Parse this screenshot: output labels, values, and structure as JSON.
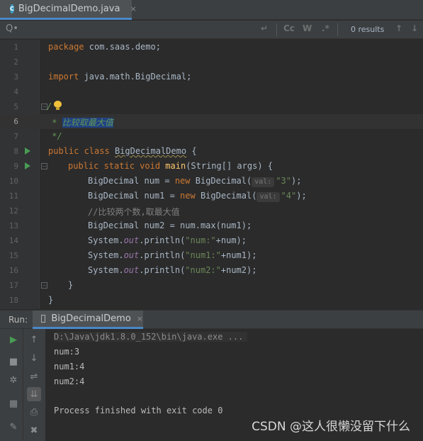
{
  "editor_tab": {
    "label": "BigDecimalDemo.java",
    "close": "×"
  },
  "search": {
    "icon": "Q•",
    "value": "",
    "results": "0 results",
    "btn_cc": "Cc",
    "btn_w": "W",
    "btn_regex": ".*"
  },
  "code_lines": [
    {
      "n": "1"
    },
    {
      "n": "2"
    },
    {
      "n": "3"
    },
    {
      "n": "4"
    },
    {
      "n": "5"
    },
    {
      "n": "6"
    },
    {
      "n": "7"
    },
    {
      "n": "8"
    },
    {
      "n": "9"
    },
    {
      "n": "10"
    },
    {
      "n": "11"
    },
    {
      "n": "12"
    },
    {
      "n": "13"
    },
    {
      "n": "14"
    },
    {
      "n": "15"
    },
    {
      "n": "16"
    },
    {
      "n": "17"
    },
    {
      "n": "18"
    }
  ],
  "code": {
    "l1_kw": "package",
    "l1_rest": " com.saas.demo;",
    "l3_kw": "import",
    "l3_rest": " java.math.BigDecimal;",
    "l5": "/",
    "l6_star": " * ",
    "l6_text": "比较取最大值",
    "l7": " */",
    "l8_kw": "public class",
    "l8_cls": "BigDecimalDemo",
    "l8_rest": " {",
    "l9_kw": "public static void",
    "l9_fn": "main",
    "l9_rest": "(String[] args) {",
    "l10_a": "BigDecimal num = ",
    "l10_new": "new",
    "l10_b": " BigDecimal(",
    "l10_hint": "val:",
    "l10_str": "\"3\"",
    "l10_c": ");",
    "l11_a": "BigDecimal num1 = ",
    "l11_new": "new",
    "l11_b": " BigDecimal(",
    "l11_hint": "val:",
    "l11_str": "\"4\"",
    "l11_c": ");",
    "l12": "//比较两个数,取最大值",
    "l13": "BigDecimal num2 = num.max(num1);",
    "l14_a": "System.",
    "l14_out": "out",
    "l14_b": ".println(",
    "l14_str": "\"num:\"",
    "l14_c": "+num);",
    "l15_a": "System.",
    "l15_out": "out",
    "l15_b": ".println(",
    "l15_str": "\"num1:\"",
    "l15_c": "+num1);",
    "l16_a": "System.",
    "l16_out": "out",
    "l16_b": ".println(",
    "l16_str": "\"num2:\"",
    "l16_c": "+num2);",
    "l17": "}",
    "l18": "}"
  },
  "run": {
    "title": "Run:",
    "tab_label": "BigDecimalDemo",
    "tab_close": "×"
  },
  "console": {
    "cmd": "D:\\Java\\jdk1.8.0_152\\bin\\java.exe ...",
    "out1": "num:3",
    "out2": "num1:4",
    "out3": "num2:4",
    "finish": "Process finished with exit code 0"
  },
  "watermark": "CSDN @这人很懒没留下什么",
  "colors": {
    "keyword": "#cc7832",
    "string": "#6a8759",
    "doc_comment": "#629755",
    "field": "#9876aa",
    "method": "#ffc66d",
    "accent": "#4a88c7",
    "run_green": "#499c54"
  }
}
